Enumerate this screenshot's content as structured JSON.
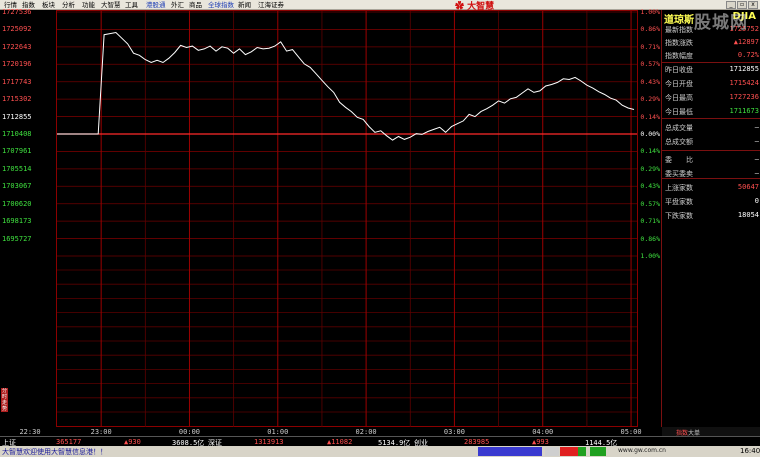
{
  "menu": {
    "items": [
      "行情",
      "指数",
      "板块",
      "分析",
      "功能",
      "大智慧",
      "工具",
      "港股通",
      "外汇",
      "商品",
      "全球指数",
      "新闻",
      "江海证券"
    ],
    "highlighted": [
      "港股通",
      "全球指数"
    ],
    "brand": "大智慧"
  },
  "chart": {
    "price_levels": [
      "1727536",
      "1725092",
      "1722643",
      "1720196",
      "1717743",
      "1715302",
      "1712855",
      "1710408",
      "1707961",
      "1705514",
      "1703067",
      "1700620",
      "1698173",
      "1695727"
    ],
    "pct_levels": [
      "1.00%",
      "0.86%",
      "0.71%",
      "0.57%",
      "0.43%",
      "0.29%",
      "0.14%",
      "0.00%",
      "0.14%",
      "0.29%",
      "0.43%",
      "0.57%",
      "0.71%",
      "0.86%",
      "1.00%"
    ],
    "time_labels": [
      "22:30",
      "23:00",
      "00:00",
      "01:00",
      "02:00",
      "03:00",
      "04:00",
      "05:00"
    ],
    "vertical_tab": "分时走势",
    "colors": {
      "grid": "#8b0000",
      "baseline": "#ff2a2a",
      "line": "#ffffff",
      "up": "#ff5050",
      "down": "#3fe03f"
    }
  },
  "chart_data": {
    "type": "line",
    "title": "",
    "xlabel": "",
    "ylabel": "",
    "x": [
      "22:30",
      "22:34",
      "22:38",
      "22:42",
      "22:46",
      "22:50",
      "22:54",
      "22:58",
      "23:02",
      "23:06",
      "23:10",
      "23:14",
      "23:18",
      "23:22",
      "23:26",
      "23:30",
      "23:34",
      "23:38",
      "23:42",
      "23:46",
      "23:50",
      "23:54",
      "23:58",
      "00:02",
      "00:06",
      "00:10",
      "00:14",
      "00:18",
      "00:22",
      "00:26",
      "00:30",
      "00:34",
      "00:38",
      "00:42",
      "00:46",
      "00:50",
      "00:54",
      "00:58",
      "01:02",
      "01:06",
      "01:10",
      "01:14",
      "01:18",
      "01:22",
      "01:26",
      "01:30",
      "01:34",
      "01:38",
      "01:42",
      "01:46",
      "01:50",
      "01:54",
      "01:58",
      "02:02",
      "02:06",
      "02:10",
      "02:14",
      "02:18",
      "02:22",
      "02:26",
      "02:30",
      "02:34",
      "02:38",
      "02:42",
      "02:46",
      "02:50",
      "02:54",
      "02:58",
      "03:02",
      "03:06",
      "03:10",
      "03:14",
      "03:18",
      "03:22",
      "03:26",
      "03:30",
      "03:34",
      "03:38",
      "03:42",
      "03:46",
      "03:50",
      "03:54",
      "03:58",
      "04:02",
      "04:06",
      "04:10",
      "04:14",
      "04:18",
      "04:22",
      "04:26",
      "04:30",
      "04:34",
      "04:38",
      "04:42",
      "04:46",
      "04:50",
      "04:54",
      "04:58",
      "05:02"
    ],
    "values": [
      1712855,
      1712855,
      1712855,
      1712855,
      1712855,
      1712855,
      1712855,
      1712855,
      1726800,
      1726950,
      1727100,
      1726300,
      1725500,
      1724200,
      1723900,
      1723300,
      1722900,
      1723200,
      1722900,
      1723500,
      1724300,
      1725300,
      1725000,
      1725200,
      1724600,
      1724800,
      1725200,
      1724500,
      1725100,
      1724900,
      1724200,
      1724800,
      1724000,
      1724400,
      1725000,
      1724800,
      1724900,
      1725200,
      1725800,
      1724500,
      1724700,
      1723700,
      1722700,
      1722200,
      1721300,
      1720400,
      1719500,
      1718700,
      1717300,
      1716600,
      1716000,
      1715200,
      1714900,
      1713900,
      1713100,
      1713300,
      1712600,
      1712000,
      1712500,
      1712100,
      1712400,
      1712900,
      1712800,
      1713200,
      1713500,
      1713800,
      1713100,
      1713900,
      1714300,
      1714700,
      1715600,
      1715300,
      1716000,
      1716400,
      1716900,
      1717500,
      1717200,
      1717800,
      1718000,
      1718600,
      1719200,
      1718700,
      1718900,
      1719600,
      1719800,
      1720100,
      1720600,
      1720500,
      1720800,
      1720300,
      1719700,
      1719300,
      1718800,
      1718400,
      1717900,
      1717600,
      1716900,
      1716500,
      1716300
    ],
    "baseline": 1712855,
    "ylim": [
      1695727,
      1729983
    ],
    "pct_range": [
      -1.0,
      1.0
    ],
    "grid": true
  },
  "rpanel": {
    "title": "道琼斯",
    "code": "DJIA",
    "rows": [
      {
        "label": "最新指数",
        "value": "1725752",
        "cls": "up"
      },
      {
        "label": "指数涨跌",
        "value": "▲12897",
        "cls": "up"
      },
      {
        "label": "指数幅度",
        "value": "0.72%",
        "cls": "up"
      },
      {
        "label": "昨日收盘",
        "value": "1712855",
        "cls": "base"
      },
      {
        "label": "今日开盘",
        "value": "1715424",
        "cls": "up"
      },
      {
        "label": "今日最高",
        "value": "1727236",
        "cls": "up"
      },
      {
        "label": "今日最低",
        "value": "1711673",
        "cls": "dn"
      },
      {
        "label": "总成交量",
        "value": "—",
        "cls": "base"
      },
      {
        "label": "总成交额",
        "value": "—",
        "cls": "base"
      },
      {
        "label": "委　　比",
        "value": "—",
        "cls": "base"
      },
      {
        "label": "委买委卖",
        "value": "—",
        "cls": "base"
      },
      {
        "label": "上涨家数",
        "value": "50647",
        "cls": "up"
      },
      {
        "label": "平盘家数",
        "value": "0",
        "cls": "base"
      },
      {
        "label": "下跌家数",
        "value": "18054",
        "cls": "base"
      }
    ],
    "bottom_tabs": [
      "指数",
      "大单"
    ]
  },
  "watermark": "股城网",
  "status": {
    "items": [
      {
        "text": "上证",
        "cls": "base"
      },
      {
        "text": "365177",
        "cls": "up"
      },
      {
        "text": "▲930",
        "cls": "up"
      },
      {
        "text": "3608.5亿",
        "cls": "base"
      },
      {
        "text": "深证",
        "cls": "base"
      },
      {
        "text": "1313913",
        "cls": "up"
      },
      {
        "text": "▲11082",
        "cls": "up"
      },
      {
        "text": "5134.9亿",
        "cls": "base"
      },
      {
        "text": "创业",
        "cls": "base"
      },
      {
        "text": "283985",
        "cls": "up"
      },
      {
        "text": "▲993",
        "cls": "up"
      },
      {
        "text": "1144.5亿",
        "cls": "base"
      }
    ],
    "ticker": "大智慧欢迎使用大智慧信息港！！",
    "url": "www.gw.com.cn",
    "clock": "16:40"
  }
}
